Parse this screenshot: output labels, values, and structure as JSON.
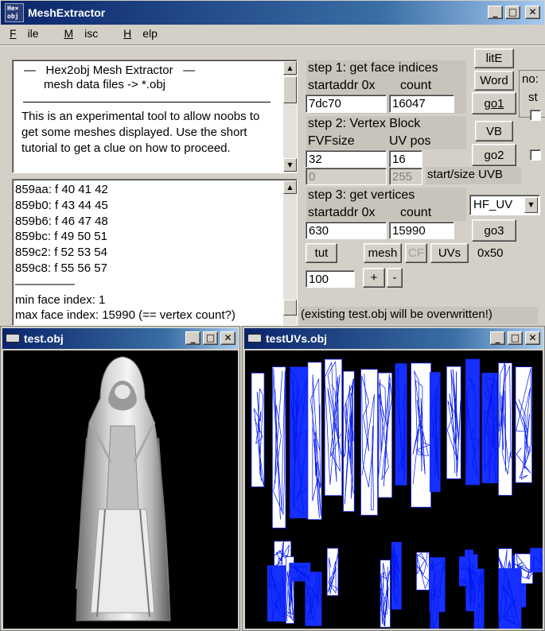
{
  "main_window": {
    "app_icon_text": "He×\nobj",
    "title": "MeshExtractor",
    "controls": {
      "minimize": "_",
      "maximize": "□",
      "close": "✕"
    }
  },
  "menu": [
    {
      "label": "File",
      "mnemonic": "F",
      "rest": "ile"
    },
    {
      "label": "Misc",
      "mnemonic": "M",
      "rest": "isc"
    },
    {
      "label": "Help",
      "mnemonic": "H",
      "rest": "elp"
    }
  ],
  "info_box": {
    "heading": "—   Hex2obj Mesh Extractor   —",
    "subheading": "mesh data files -> *.obj",
    "divider": "——————————————————————",
    "body": "This is an experimental tool to allow noobs to get some meshes displayed. Use the short tutorial to get a clue on how to proceed."
  },
  "log": {
    "lines": [
      "859aa: f  40 41 42",
      "859b0: f  43 44 45",
      "859b6: f  46 47 48",
      "859bc: f  49 50 51",
      "859c2: f  52 53 54",
      "859c8: f  55 56 57",
      "—————",
      "min face index: 1",
      "max face index: 15990 (== vertex count?)"
    ]
  },
  "step1": {
    "title": "step 1: get face indices",
    "startaddr_label": "startaddr 0x",
    "count_label": "count",
    "startaddr_value": "7dc70",
    "count_value": "16047",
    "go_label": "go1"
  },
  "step2": {
    "title": "step 2: Vertex Block",
    "fvf_label": "FVFsize",
    "uvpos_label": "UV pos",
    "fvf_value": "32",
    "uvpos_value": "16",
    "uvb_start": "0",
    "uvb_size": "255",
    "uvb_label": "start/size UVB",
    "go_label": "go2"
  },
  "step3": {
    "title": "step 3: get vertices",
    "startaddr_label": "startaddr 0x",
    "count_label": "count",
    "startaddr_value": "630",
    "count_value": "15990",
    "go_label": "go3",
    "uv_format": "HF_UV"
  },
  "side_buttons": {
    "lite": "litE",
    "word": "Word",
    "vb": "VB",
    "no_clipped": "no:",
    "st_clipped": "st"
  },
  "bottom_buttons": {
    "tut": "tut",
    "mesh": "mesh",
    "cf": "CF",
    "uvs": "UVs",
    "offset": "0x50",
    "value": "100",
    "plus": "+",
    "minus": "-"
  },
  "status": "(existing test.obj will be overwritten!)",
  "viewer_left": {
    "title": "test.obj"
  },
  "viewer_right": {
    "title": "testUVs.obj"
  }
}
